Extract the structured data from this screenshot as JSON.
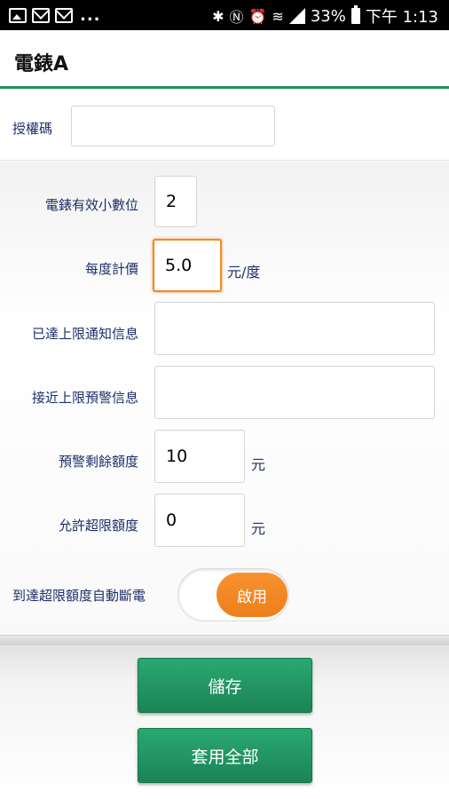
{
  "status_bar": {
    "battery": "33%",
    "time": "下午 1:13",
    "more": "..."
  },
  "header": {
    "title": "電錶A"
  },
  "auth": {
    "label": "授權碼",
    "value": ""
  },
  "form": {
    "decimal_places": {
      "label": "電錶有效小數位",
      "value": "2"
    },
    "price_per_kwh": {
      "label": "每度計價",
      "value": "5.0",
      "unit": "元/度"
    },
    "limit_reached_msg": {
      "label": "已達上限通知信息",
      "value": ""
    },
    "near_limit_msg": {
      "label": "接近上限預警信息",
      "value": ""
    },
    "warning_remaining": {
      "label": "預警剩餘額度",
      "value": "10",
      "unit": "元"
    },
    "allowed_over_limit": {
      "label": "允許超限額度",
      "value": "0",
      "unit": "元"
    },
    "auto_cutoff": {
      "label": "到達超限額度自動斷電",
      "toggle_label": "啟用"
    }
  },
  "buttons": {
    "save": "儲存",
    "apply_all": "套用全部"
  },
  "colors": {
    "accent_green": "#1f8f5c",
    "toggle_orange": "#f08a24",
    "label_blue": "#1e2f6b"
  }
}
